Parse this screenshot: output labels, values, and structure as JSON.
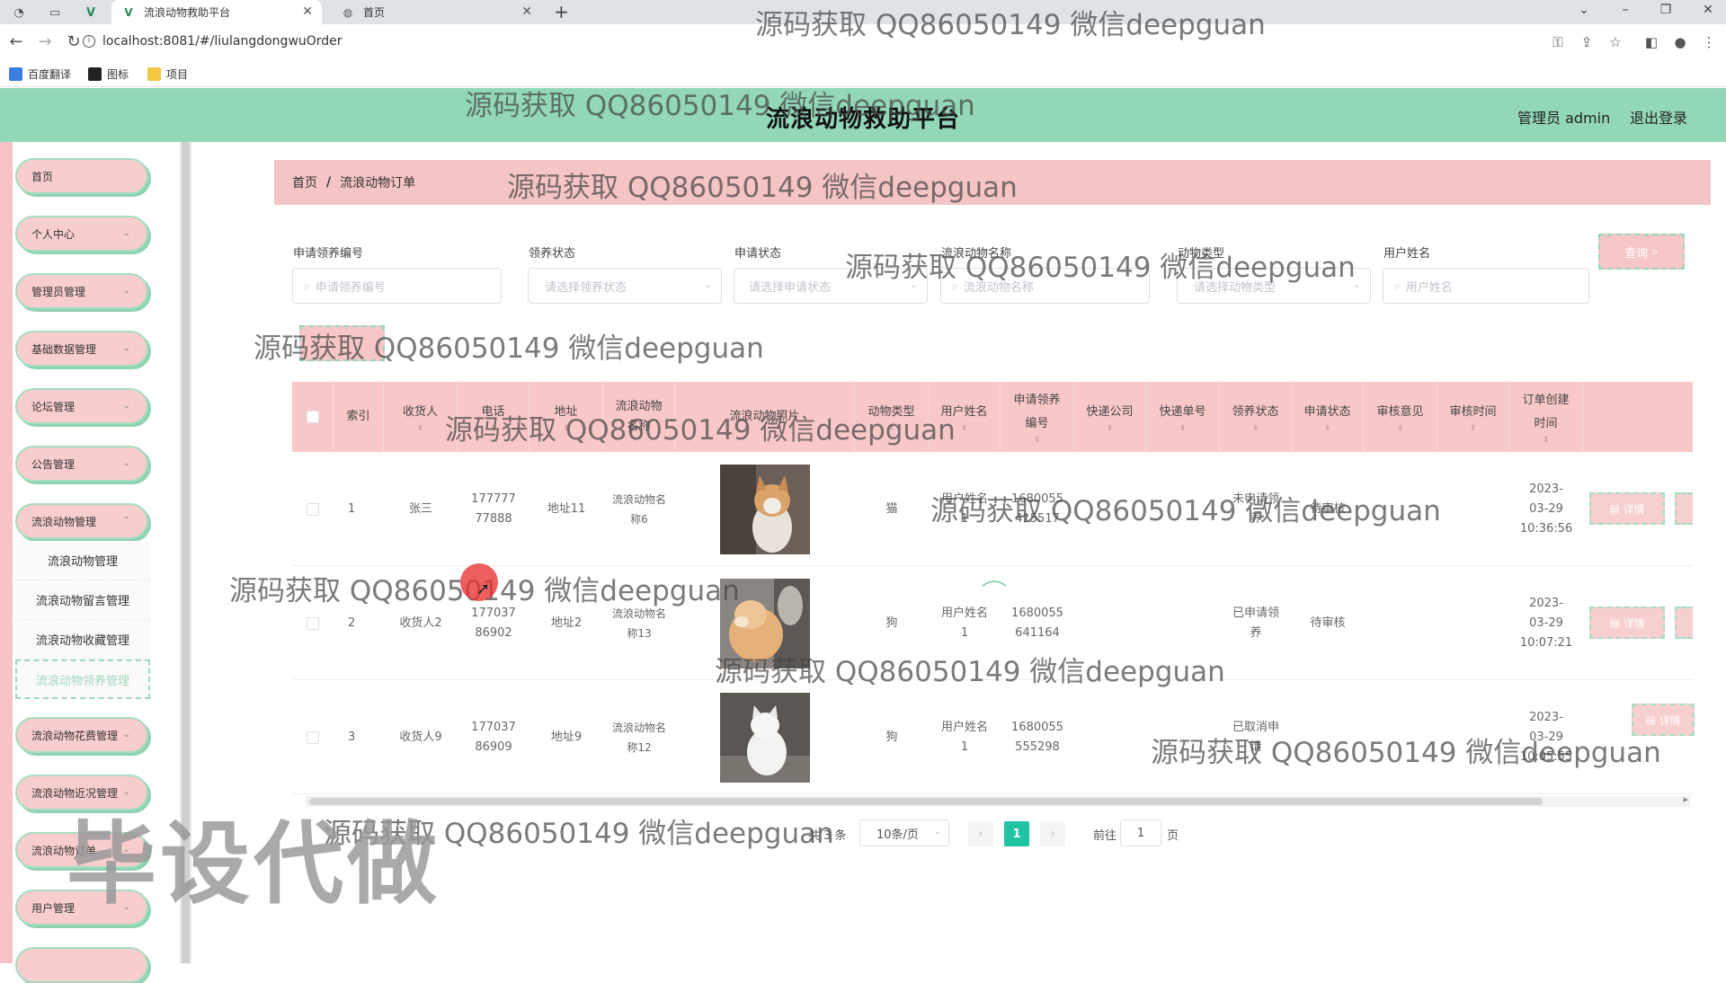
{
  "browser": {
    "tabs": [
      {
        "title": "流浪动物救助平台",
        "active": true
      },
      {
        "title": "首页",
        "active": false
      }
    ],
    "url": "localhost:8081/#/liulangdongwuOrder",
    "bookmarks": [
      "百度翻译",
      "图标",
      "项目"
    ]
  },
  "header": {
    "title": "流浪动物救助平台",
    "admin_label": "管理员 admin",
    "logout_label": "退出登录",
    "bg_color": "#93d8b6"
  },
  "sidebar": {
    "items": [
      {
        "label": "首页",
        "has_arrow": false
      },
      {
        "label": "个人中心",
        "has_arrow": true
      },
      {
        "label": "管理员管理",
        "has_arrow": true
      },
      {
        "label": "基础数据管理",
        "has_arrow": true
      },
      {
        "label": "论坛管理",
        "has_arrow": true
      },
      {
        "label": "公告管理",
        "has_arrow": true
      },
      {
        "label": "流浪动物管理",
        "has_arrow": true
      },
      {
        "label": "流浪动物花费管理",
        "has_arrow": true
      },
      {
        "label": "流浪动物近况管理",
        "has_arrow": true
      },
      {
        "label": "流浪动物订单",
        "has_arrow": true
      },
      {
        "label": "用户管理",
        "has_arrow": true
      }
    ],
    "submenu": [
      {
        "label": "流浪动物管理",
        "active": false
      },
      {
        "label": "流浪动物留言管理",
        "active": false
      },
      {
        "label": "流浪动物收藏管理",
        "active": false
      },
      {
        "label": "流浪动物领养管理",
        "active": true
      }
    ]
  },
  "breadcrumb": {
    "home": "首页",
    "separator": "/",
    "current": "流浪动物订单"
  },
  "filters": [
    {
      "label": "申请领养编号",
      "placeholder": "申请领养编号",
      "type": "search"
    },
    {
      "label": "领养状态",
      "placeholder": "请选择领养状态",
      "type": "select"
    },
    {
      "label": "申请状态",
      "placeholder": "请选择申请状态",
      "type": "select"
    },
    {
      "label": "流浪动物名称",
      "placeholder": "流浪动物名称",
      "type": "search"
    },
    {
      "label": "动物类型",
      "placeholder": "请选择动物类型",
      "type": "select"
    },
    {
      "label": "用户姓名",
      "placeholder": "用户姓名",
      "type": "search"
    }
  ],
  "query_button": "查询",
  "table": {
    "columns": [
      "索引",
      "收货人",
      "电话",
      "地址",
      "流浪动物名称",
      "流浪动物照片",
      "动物类型",
      "用户姓名",
      "申请领养编号",
      "快递公司",
      "快递单号",
      "领养状态",
      "申请状态",
      "审核意见",
      "审核时间",
      "订单创建时间"
    ],
    "rows": [
      {
        "index": "1",
        "receiver": "张三",
        "phone": "17777777888",
        "address": "地址11",
        "animal_name": "流浪动物名称6",
        "animal_type": "猫",
        "user_name": "用户姓名1",
        "apply_no": "1680055415517",
        "express_company": "",
        "express_no": "",
        "adopt_status": "未申请领养",
        "apply_status": "待审核",
        "review_note": "",
        "review_time": "",
        "created": "2023-03-29 10:36:56",
        "detail_label": "详情"
      },
      {
        "index": "2",
        "receiver": "收货人2",
        "phone": "17703786902",
        "address": "地址2",
        "animal_name": "流浪动物名称13",
        "animal_type": "狗",
        "user_name": "用户姓名1",
        "apply_no": "1680055641164",
        "express_company": "",
        "express_no": "",
        "adopt_status": "已申请领养",
        "apply_status": "待审核",
        "review_note": "",
        "review_time": "",
        "created": "2023-03-29 10:07:21",
        "detail_label": "详情"
      },
      {
        "index": "3",
        "receiver": "收货人9",
        "phone": "17703786909",
        "address": "地址9",
        "animal_name": "流浪动物名称12",
        "animal_type": "狗",
        "user_name": "用户姓名1",
        "apply_no": "1680055555298",
        "express_company": "",
        "express_no": "",
        "adopt_status": "已取消申请",
        "apply_status": "",
        "review_note": "",
        "review_time": "",
        "created": "2023-03-29 10:05:55",
        "detail_label": "详情"
      }
    ]
  },
  "pagination": {
    "total": "共 3 条",
    "page_size": "10条/页",
    "current_page": "1",
    "goto_label": "前往",
    "goto_value": "1",
    "page_suffix": "页"
  },
  "watermark": {
    "text": "源码获取 QQ86050149 微信deepguan",
    "big_text": "毕设代做"
  }
}
